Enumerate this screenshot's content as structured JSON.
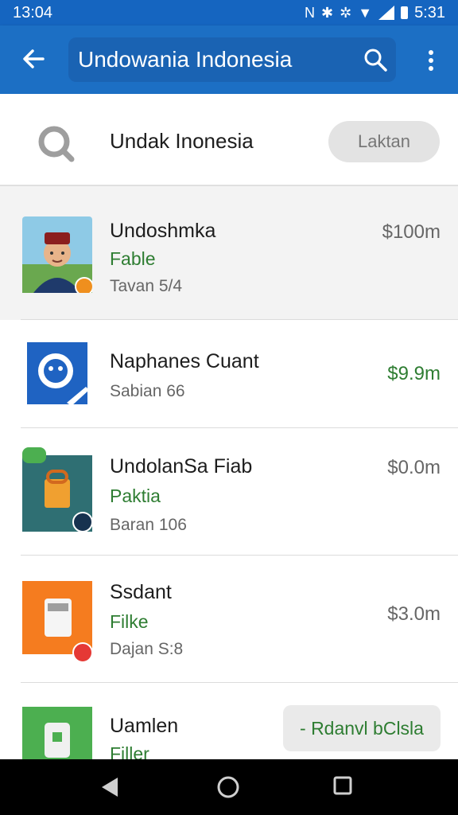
{
  "status_bar": {
    "time": "13:04",
    "clock": "5:31"
  },
  "app_bar": {
    "search_query": "Undowania Indonesia"
  },
  "filter": {
    "text": "Undak Inonesia",
    "button_label": "Laktan"
  },
  "results": [
    {
      "title": "Undoshmka",
      "subtitle": "Fable",
      "meta": "Tavan 5/4",
      "price": "$100m",
      "price_color": "#666666"
    },
    {
      "title": "Naphanes Cuant",
      "subtitle": "",
      "meta": "Sabian 66",
      "price": "$9.9m",
      "price_color": "#2e7d32"
    },
    {
      "title": "UndolanSa Fiab",
      "subtitle": "Paktia",
      "meta": "Baran 106",
      "price": "$0.0m",
      "price_color": "#666666"
    },
    {
      "title": "Ssdant",
      "subtitle": "Filke",
      "meta": "Dajan S:8",
      "price": "$3.0m",
      "price_color": "#666666"
    },
    {
      "title": "Uamlen",
      "subtitle": "Filler",
      "meta": "",
      "action_label": "- Rdanvl bClsla"
    }
  ],
  "colors": {
    "app_bar": "#1c6fc4",
    "accent_green": "#2e7d32"
  },
  "icons": [
    "back-arrow-icon",
    "search-icon",
    "more-vert-icon",
    "magnifier-icon",
    "nav-back-icon",
    "nav-home-icon",
    "nav-recents-icon"
  ]
}
